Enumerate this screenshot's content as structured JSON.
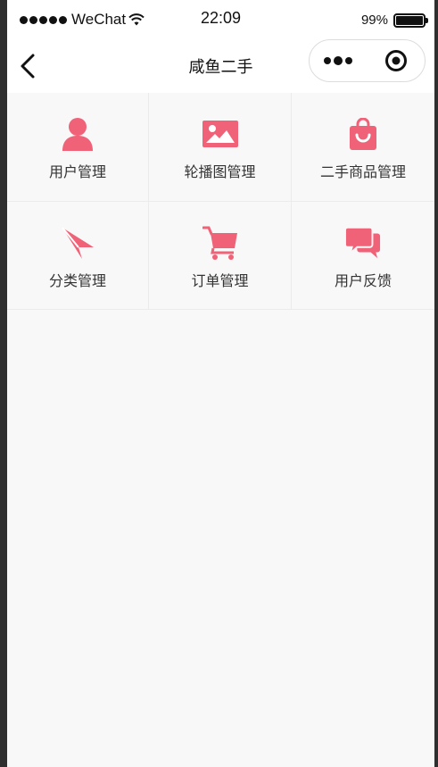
{
  "status_bar": {
    "carrier": "WeChat",
    "time": "22:09",
    "battery": "99%"
  },
  "nav": {
    "title": "咸鱼二手"
  },
  "menu": [
    {
      "label": "用户管理",
      "icon": "user-icon"
    },
    {
      "label": "轮播图管理",
      "icon": "image-icon"
    },
    {
      "label": "二手商品管理",
      "icon": "shopping-bag-icon"
    },
    {
      "label": "分类管理",
      "icon": "paper-plane-icon"
    },
    {
      "label": "订单管理",
      "icon": "cart-icon"
    },
    {
      "label": "用户反馈",
      "icon": "chat-bubbles-icon"
    }
  ],
  "colors": {
    "accent": "#f06277",
    "background": "#f8f8f8"
  }
}
